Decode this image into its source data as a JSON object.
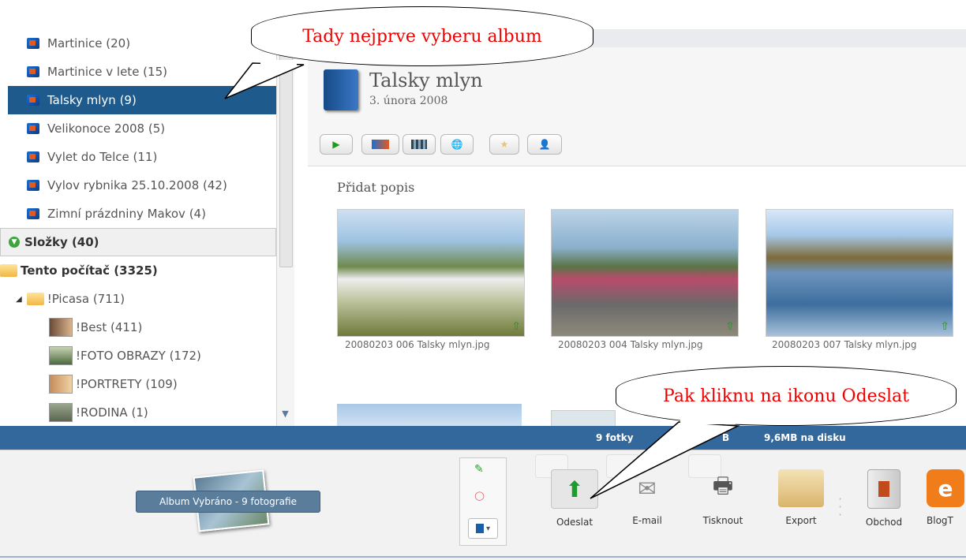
{
  "sidebar": {
    "albums": [
      {
        "label": "Martinice (20)"
      },
      {
        "label": "Martinice v lete (15)"
      },
      {
        "label": "Talsky mlyn (9)",
        "selected": true
      },
      {
        "label": "Velikonoce 2008 (5)"
      },
      {
        "label": "Vylet do Telce (11)"
      },
      {
        "label": "Vylov rybnika 25.10.2008 (42)"
      },
      {
        "label": "Zimní prázdniny Makov (4)"
      }
    ],
    "folders_section": "Složky (40)",
    "this_computer": "Tento počítač (3325)",
    "picasa_folder": "!Picasa (711)",
    "subfolders": [
      {
        "label": "!Best (411)"
      },
      {
        "label": "!FOTO OBRAZY (172)"
      },
      {
        "label": "!PORTRETY (109)"
      },
      {
        "label": "!RODINA (1)"
      }
    ]
  },
  "album": {
    "title": "Talsky mlyn",
    "date": "3. února 2008",
    "add_description": "Přidat popis"
  },
  "photos": [
    {
      "caption": "20080203 006 Talsky mlyn.jpg"
    },
    {
      "caption": "20080203 004 Talsky mlyn.jpg"
    },
    {
      "caption": "20080203 007 Talsky mlyn.jpg"
    }
  ],
  "status": {
    "count": "9 fotky",
    "size_partial": "B",
    "disk": "9,6MB na disku"
  },
  "tray": {
    "selection_label": "Album Vybráno - 9 fotografie"
  },
  "actions": [
    {
      "label": "Odeslat",
      "icon": "upload-arrow-icon"
    },
    {
      "label": "E-mail",
      "icon": "envelope-icon"
    },
    {
      "label": "Tisknout",
      "icon": "printer-icon"
    },
    {
      "label": "Export",
      "icon": "folder-icon"
    },
    {
      "label": "Obchod",
      "icon": "shop-book-icon"
    },
    {
      "label": "BlogT",
      "icon": "blogger-icon"
    }
  ],
  "callouts": {
    "top": "Tady nejprve vyberu album",
    "bottom": "Pak kliknu na ikonu Odeslat"
  },
  "colors": {
    "selected_row": "#1f5a8c",
    "statusbar": "#33689c",
    "callout_text": "#e00000"
  }
}
